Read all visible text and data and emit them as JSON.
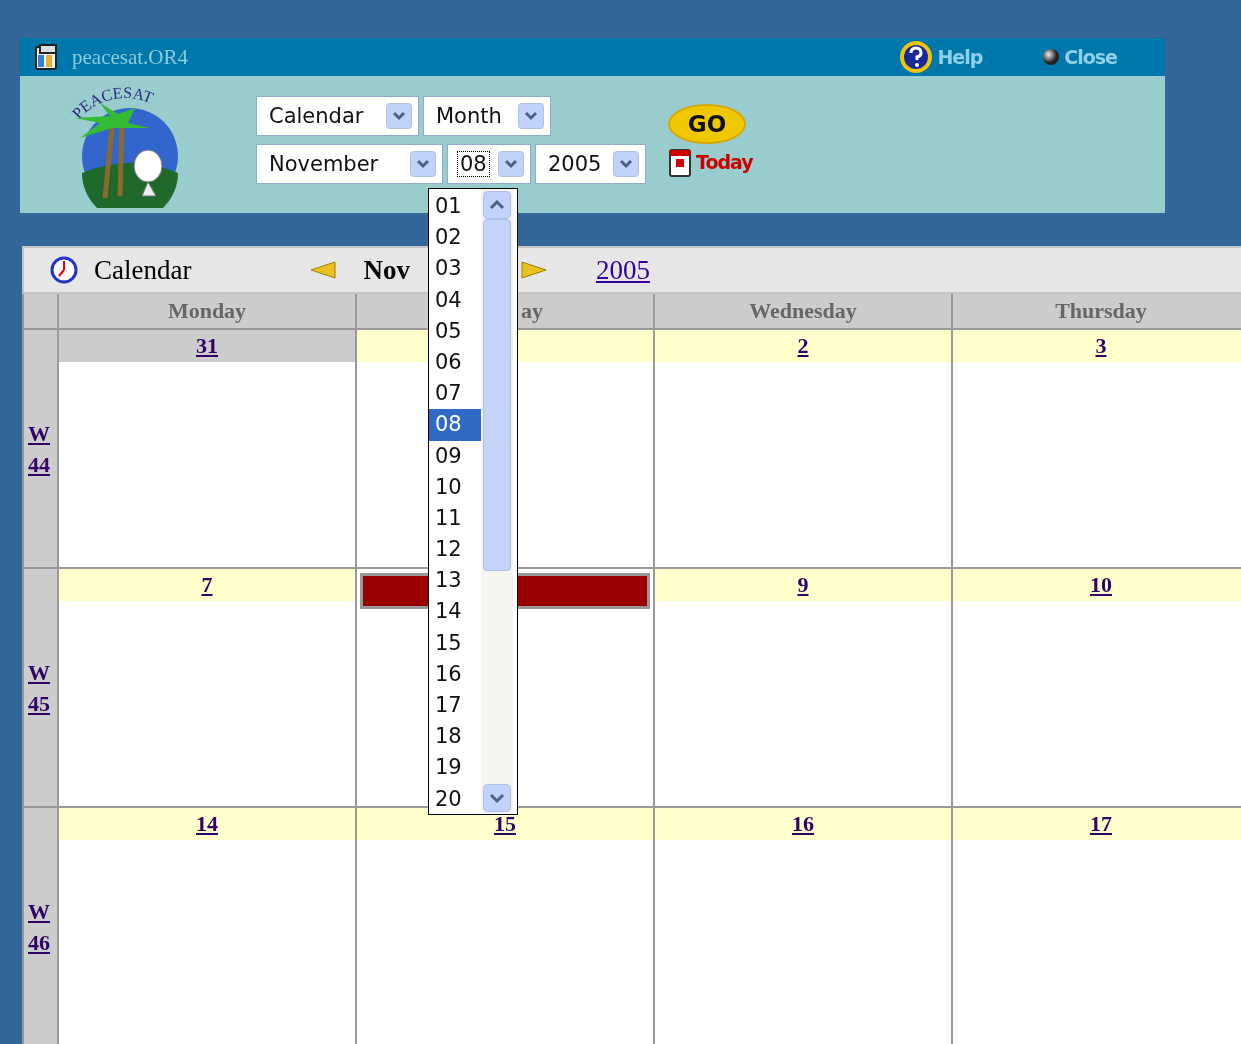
{
  "app_bar": {
    "title": "peacesat.OR4",
    "help": "Help",
    "close": "Close"
  },
  "logo_text": "PEACESAT",
  "selectors": [
    {
      "value": "Calendar",
      "focused": false
    },
    {
      "value": "Month",
      "focused": false
    },
    {
      "value": "November",
      "focused": false
    },
    {
      "value": "08",
      "focused": true
    },
    {
      "value": "2005",
      "focused": false
    }
  ],
  "go_button": "GO",
  "today_link": "Today",
  "day_list": {
    "options": [
      {
        "label": "01",
        "selected": false
      },
      {
        "label": "02",
        "selected": false
      },
      {
        "label": "03",
        "selected": false
      },
      {
        "label": "04",
        "selected": false
      },
      {
        "label": "05",
        "selected": false
      },
      {
        "label": "06",
        "selected": false
      },
      {
        "label": "07",
        "selected": false
      },
      {
        "label": "08",
        "selected": true
      },
      {
        "label": "09",
        "selected": false
      },
      {
        "label": "10",
        "selected": false
      },
      {
        "label": "11",
        "selected": false
      },
      {
        "label": "12",
        "selected": false
      },
      {
        "label": "13",
        "selected": false
      },
      {
        "label": "14",
        "selected": false
      },
      {
        "label": "15",
        "selected": false
      },
      {
        "label": "16",
        "selected": false
      },
      {
        "label": "17",
        "selected": false
      },
      {
        "label": "18",
        "selected": false
      },
      {
        "label": "19",
        "selected": false
      },
      {
        "label": "20",
        "selected": false
      }
    ]
  },
  "calendar": {
    "title": "Calendar",
    "month": "Nov",
    "year": "2005",
    "columns": [
      {
        "label": "Monday"
      },
      {
        "label": "ay"
      },
      {
        "label": "Wednesday"
      },
      {
        "label": "Thursday"
      }
    ],
    "weeks": [
      {
        "label": "W 44",
        "days": [
          {
            "date": "31",
            "in_month": false,
            "today": false
          },
          {
            "in_month": true,
            "today": false
          },
          {
            "date": "2",
            "in_month": true,
            "today": false
          },
          {
            "date": "3",
            "in_month": true,
            "today": false
          }
        ]
      },
      {
        "label": "W 45",
        "days": [
          {
            "date": "7",
            "in_month": true,
            "today": false
          },
          {
            "in_month": true,
            "today": true
          },
          {
            "date": "9",
            "in_month": true,
            "today": false
          },
          {
            "date": "10",
            "in_month": true,
            "today": false
          }
        ]
      },
      {
        "label": "W 46",
        "days": [
          {
            "date": "14",
            "in_month": true,
            "today": false
          },
          {
            "date": "15",
            "in_month": true,
            "today": false
          },
          {
            "date": "16",
            "in_month": true,
            "today": false
          },
          {
            "date": "17",
            "in_month": true,
            "today": false
          }
        ]
      }
    ]
  }
}
